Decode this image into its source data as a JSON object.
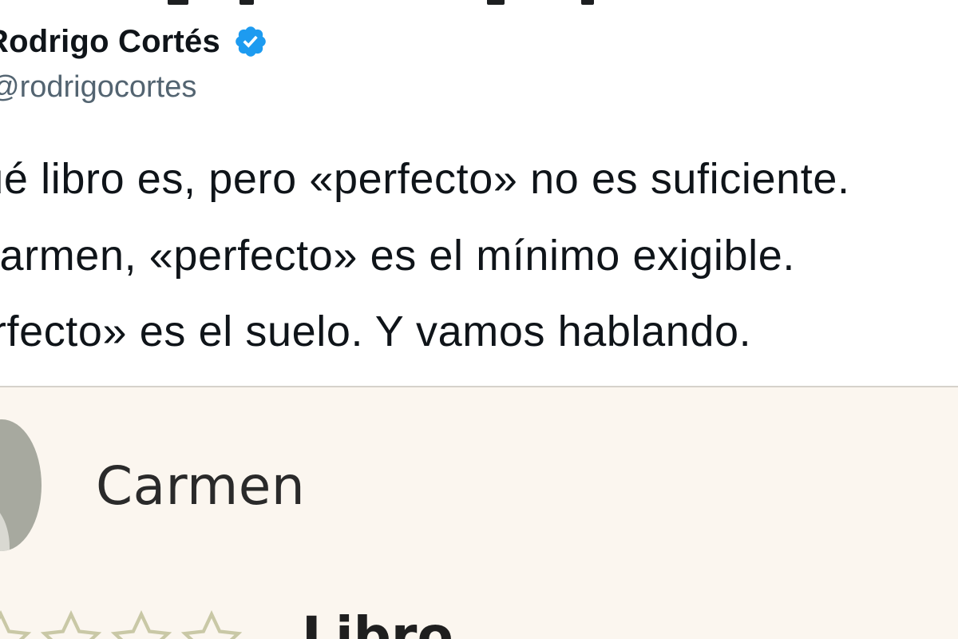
{
  "author": {
    "name": "Rodrigo Cortés",
    "handle": "@rodrigocortes",
    "verified": true
  },
  "tweet": {
    "lines": [
      "No sé qué libro es, pero «perfecto» no es suficiente.",
      "Querida Carmen, «perfecto» es el mínimo exigible.",
      "«Perfecto» es el suelo. Y vamos hablando."
    ]
  },
  "review_card": {
    "reviewer_name": "Carmen",
    "section_label": "Libro",
    "rating_stars_visible": 4
  },
  "colors": {
    "text": "#0f1419",
    "handle": "#536471",
    "verified_blue": "#1d9bf0",
    "card_bg": "#fbf6ef",
    "star_outline": "#c9c8a6"
  },
  "icons": {
    "verified": "verified-badge-icon",
    "avatar": "default-avatar-icon",
    "star": "star-outline-icon"
  }
}
